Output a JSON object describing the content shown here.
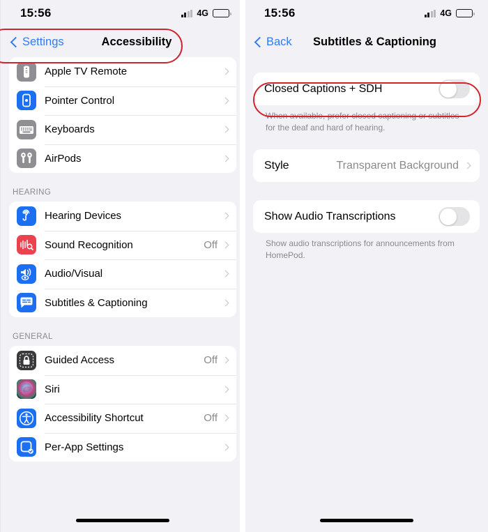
{
  "left_screen": {
    "status_bar": {
      "time": "15:56",
      "network": "4G",
      "battery_icon": "battery-icon",
      "signal_icon": "signal-bars-icon"
    },
    "nav": {
      "back_label": "Settings",
      "title": "Accessibility",
      "back_icon": "chevron-left-icon"
    },
    "groups": [
      {
        "header": "",
        "items": [
          {
            "label": "Apple TV Remote",
            "value": "",
            "icon": "apple-tv-remote-icon",
            "icon_color": "#8e8e93"
          },
          {
            "label": "Pointer Control",
            "value": "",
            "icon": "pointer-control-icon",
            "icon_color": "#1d6ff2"
          },
          {
            "label": "Keyboards",
            "value": "",
            "icon": "keyboard-icon",
            "icon_color": "#8e8e93"
          },
          {
            "label": "AirPods",
            "value": "",
            "icon": "airpods-icon",
            "icon_color": "#8e8e93"
          }
        ]
      },
      {
        "header": "HEARING",
        "items": [
          {
            "label": "Hearing Devices",
            "value": "",
            "icon": "ear-icon",
            "icon_color": "#1d6ff2"
          },
          {
            "label": "Sound Recognition",
            "value": "Off",
            "icon": "sound-recognition-icon",
            "icon_color": "#eb4250"
          },
          {
            "label": "Audio/Visual",
            "value": "",
            "icon": "audio-visual-icon",
            "icon_color": "#1d6ff2"
          },
          {
            "label": "Subtitles & Captioning",
            "value": "",
            "icon": "subtitles-icon",
            "icon_color": "#1d6ff2"
          }
        ]
      },
      {
        "header": "GENERAL",
        "items": [
          {
            "label": "Guided Access",
            "value": "Off",
            "icon": "guided-access-lock-icon",
            "icon_color": "#3a3a3c"
          },
          {
            "label": "Siri",
            "value": "",
            "icon": "siri-icon",
            "icon_color": "#1c1c1e"
          },
          {
            "label": "Accessibility Shortcut",
            "value": "Off",
            "icon": "accessibility-person-icon",
            "icon_color": "#1d6ff2"
          },
          {
            "label": "Per-App Settings",
            "value": "",
            "icon": "per-app-settings-icon",
            "icon_color": "#1d6ff2"
          }
        ]
      }
    ]
  },
  "right_screen": {
    "status_bar": {
      "time": "15:56",
      "network": "4G",
      "battery_icon": "battery-icon",
      "signal_icon": "signal-bars-icon"
    },
    "nav": {
      "back_label": "Back",
      "title": "Subtitles & Captioning",
      "back_icon": "chevron-left-icon"
    },
    "closed_captions": {
      "label": "Closed Captions + SDH",
      "toggle_state": "off",
      "footnote": "When available, prefer closed captioning or subtitles for the deaf and hard of hearing."
    },
    "style_row": {
      "label": "Style",
      "value": "Transparent Background",
      "chevron_icon": "chevron-right-icon"
    },
    "audio_transcriptions": {
      "label": "Show Audio Transcriptions",
      "toggle_state": "off",
      "footnote": "Show audio transcriptions for announcements from HomePod."
    }
  },
  "annotations": {
    "accent_color": "#d1242f",
    "highlight_nav": "Settings / Accessibility navigation bar",
    "highlight_closed_captions": "Closed Captions + SDH row"
  }
}
